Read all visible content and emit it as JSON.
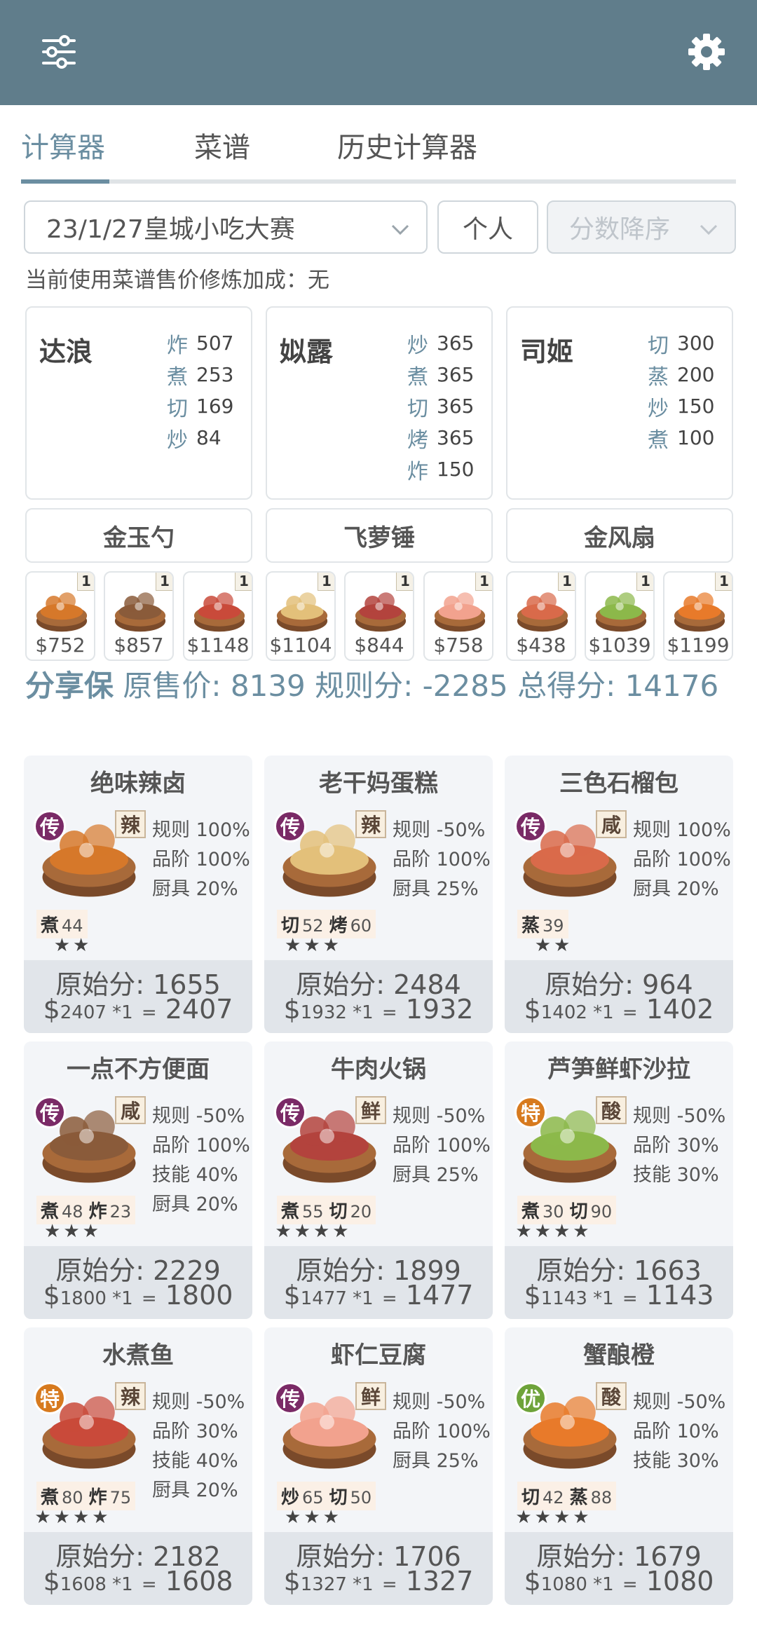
{
  "header": {
    "menu_icon": "sliders-icon",
    "settings_icon": "gear-icon"
  },
  "tabs": [
    {
      "label": "计算器"
    },
    {
      "label": "菜谱"
    },
    {
      "label": "历史计算器"
    }
  ],
  "controls": {
    "contest": "23/1/27皇城小吃大赛",
    "mode": "个人",
    "sort": "分数降序"
  },
  "note": "当前使用菜谱售价修炼加成：无",
  "chefs": [
    {
      "name": "达浪",
      "skills": [
        {
          "k": "炸",
          "v": "507"
        },
        {
          "k": "煮",
          "v": "253"
        },
        {
          "k": "切",
          "v": "169"
        },
        {
          "k": "炒",
          "v": "84"
        }
      ]
    },
    {
      "name": "姒露",
      "skills": [
        {
          "k": "炒",
          "v": "365"
        },
        {
          "k": "煮",
          "v": "365"
        },
        {
          "k": "切",
          "v": "365"
        },
        {
          "k": "烤",
          "v": "365"
        },
        {
          "k": "炸",
          "v": "150"
        }
      ]
    },
    {
      "name": "司姬",
      "skills": [
        {
          "k": "切",
          "v": "300"
        },
        {
          "k": "蒸",
          "v": "200"
        },
        {
          "k": "炒",
          "v": "150"
        },
        {
          "k": "煮",
          "v": "100"
        }
      ]
    }
  ],
  "equipment": [
    "金玉勺",
    "飞萝锤",
    "金风扇"
  ],
  "minis": [
    {
      "badge": "1",
      "price": "$752",
      "color": "#d6782a"
    },
    {
      "badge": "1",
      "price": "$857",
      "color": "#8a5b3a"
    },
    {
      "badge": "1",
      "price": "$1148",
      "color": "#c94a3a"
    },
    {
      "badge": "1",
      "price": "$1104",
      "color": "#e3c07a"
    },
    {
      "badge": "1",
      "price": "$844",
      "color": "#b3433d"
    },
    {
      "badge": "1",
      "price": "$758",
      "color": "#f2a28e"
    },
    {
      "badge": "1",
      "price": "$438",
      "color": "#d96a4a"
    },
    {
      "badge": "1",
      "price": "$1039",
      "color": "#8cb84a"
    },
    {
      "badge": "1",
      "price": "$1199",
      "color": "#e87a2a"
    }
  ],
  "summary": {
    "label": "分享保",
    "orig_label": "原售价:",
    "orig": "8139",
    "rule_label": "规则分:",
    "rule": "-2285",
    "total_label": "总得分:",
    "total": "14176"
  },
  "cards": [
    {
      "title": "绝味辣卤",
      "rarity": "传",
      "rarity_color": "#7a2a66",
      "cond": "辣",
      "dish_color": "#d6782a",
      "stats": [
        "规则 100%",
        "品阶 100%",
        "厨具 20%"
      ],
      "reqs": [
        {
          "k": "煮",
          "v": "44"
        }
      ],
      "stars": "★★",
      "orig": "原始分: 1655",
      "calc_base": "2407 *1",
      "calc_total": "2407"
    },
    {
      "title": "老干妈蛋糕",
      "rarity": "传",
      "rarity_color": "#7a2a66",
      "cond": "辣",
      "dish_color": "#e3c07a",
      "stats": [
        "规则 -50%",
        "品阶 100%",
        "厨具 25%"
      ],
      "reqs": [
        {
          "k": "切",
          "v": "52"
        },
        {
          "k": "烤",
          "v": "60"
        }
      ],
      "stars": "★★★",
      "orig": "原始分: 2484",
      "calc_base": "1932 *1",
      "calc_total": "1932"
    },
    {
      "title": "三色石榴包",
      "rarity": "传",
      "rarity_color": "#7a2a66",
      "cond": "咸",
      "dish_color": "#d96a4a",
      "stats": [
        "规则 100%",
        "品阶 100%",
        "厨具 20%"
      ],
      "reqs": [
        {
          "k": "蒸",
          "v": "39"
        }
      ],
      "stars": "★★",
      "orig": "原始分: 964",
      "calc_base": "1402 *1",
      "calc_total": "1402"
    },
    {
      "title": "一点不方便面",
      "rarity": "传",
      "rarity_color": "#7a2a66",
      "cond": "咸",
      "dish_color": "#8a5b3a",
      "stats": [
        "规则 -50%",
        "品阶 100%",
        "技能 40%",
        "厨具 20%"
      ],
      "reqs": [
        {
          "k": "煮",
          "v": "48"
        },
        {
          "k": "炸",
          "v": "23"
        }
      ],
      "stars": "★★★",
      "orig": "原始分: 2229",
      "calc_base": "1800 *1",
      "calc_total": "1800"
    },
    {
      "title": "牛肉火锅",
      "rarity": "传",
      "rarity_color": "#7a2a66",
      "cond": "鲜",
      "dish_color": "#b3433d",
      "stats": [
        "规则 -50%",
        "品阶 100%",
        "厨具 25%"
      ],
      "reqs": [
        {
          "k": "煮",
          "v": "55"
        },
        {
          "k": "切",
          "v": "20"
        }
      ],
      "stars": "★★★★",
      "orig": "原始分: 1899",
      "calc_base": "1477 *1",
      "calc_total": "1477"
    },
    {
      "title": "芦笋鲜虾沙拉",
      "rarity": "特",
      "rarity_color": "#d77a1e",
      "cond": "酸",
      "dish_color": "#8cb84a",
      "stats": [
        "规则 -50%",
        "品阶 30%",
        "技能 30%"
      ],
      "reqs": [
        {
          "k": "煮",
          "v": "30"
        },
        {
          "k": "切",
          "v": "90"
        }
      ],
      "stars": "★★★★",
      "orig": "原始分: 1663",
      "calc_base": "1143 *1",
      "calc_total": "1143"
    },
    {
      "title": "水煮鱼",
      "rarity": "特",
      "rarity_color": "#d77a1e",
      "cond": "辣",
      "dish_color": "#c94a3a",
      "stats": [
        "规则 -50%",
        "品阶 30%",
        "技能 40%",
        "厨具 20%"
      ],
      "reqs": [
        {
          "k": "煮",
          "v": "80"
        },
        {
          "k": "炸",
          "v": "75"
        }
      ],
      "stars": "★★★★",
      "orig": "原始分: 2182",
      "calc_base": "1608 *1",
      "calc_total": "1608"
    },
    {
      "title": "虾仁豆腐",
      "rarity": "传",
      "rarity_color": "#7a2a66",
      "cond": "鲜",
      "dish_color": "#f2a28e",
      "stats": [
        "规则 -50%",
        "品阶 100%",
        "厨具 25%"
      ],
      "reqs": [
        {
          "k": "炒",
          "v": "65"
        },
        {
          "k": "切",
          "v": "50"
        }
      ],
      "stars": "★★★",
      "orig": "原始分: 1706",
      "calc_base": "1327 *1",
      "calc_total": "1327"
    },
    {
      "title": "蟹酿橙",
      "rarity": "优",
      "rarity_color": "#6ea33a",
      "cond": "酸",
      "dish_color": "#e87a2a",
      "stats": [
        "规则 -50%",
        "品阶 10%",
        "技能 30%"
      ],
      "reqs": [
        {
          "k": "切",
          "v": "42"
        },
        {
          "k": "蒸",
          "v": "88"
        }
      ],
      "stars": "★★★★",
      "orig": "原始分: 1679",
      "calc_base": "1080 *1",
      "calc_total": "1080"
    }
  ],
  "currency": "$",
  "eq": "="
}
